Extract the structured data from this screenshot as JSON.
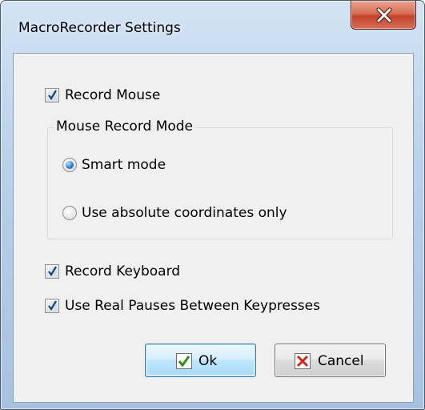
{
  "window": {
    "title": "MacroRecorder Settings"
  },
  "record_mouse": {
    "label": "Record Mouse",
    "checked": true
  },
  "mouse_mode_group": {
    "title": "Mouse Record Mode",
    "options": [
      {
        "label": "Smart mode",
        "selected": true
      },
      {
        "label": "Use absolute coordinates only",
        "selected": false
      }
    ]
  },
  "record_keyboard": {
    "label": "Record Keyboard",
    "checked": true
  },
  "real_pauses": {
    "label": "Use Real Pauses Between Keypresses",
    "checked": true
  },
  "buttons": {
    "ok_label": "Ok",
    "cancel_label": "Cancel"
  },
  "colors": {
    "check_green": "#2e8b1f",
    "cancel_red": "#d12a1c",
    "close_red": "#c2442a"
  },
  "icons": {
    "close": "close-x-icon",
    "ok": "green-check-icon",
    "cancel": "red-x-icon"
  }
}
